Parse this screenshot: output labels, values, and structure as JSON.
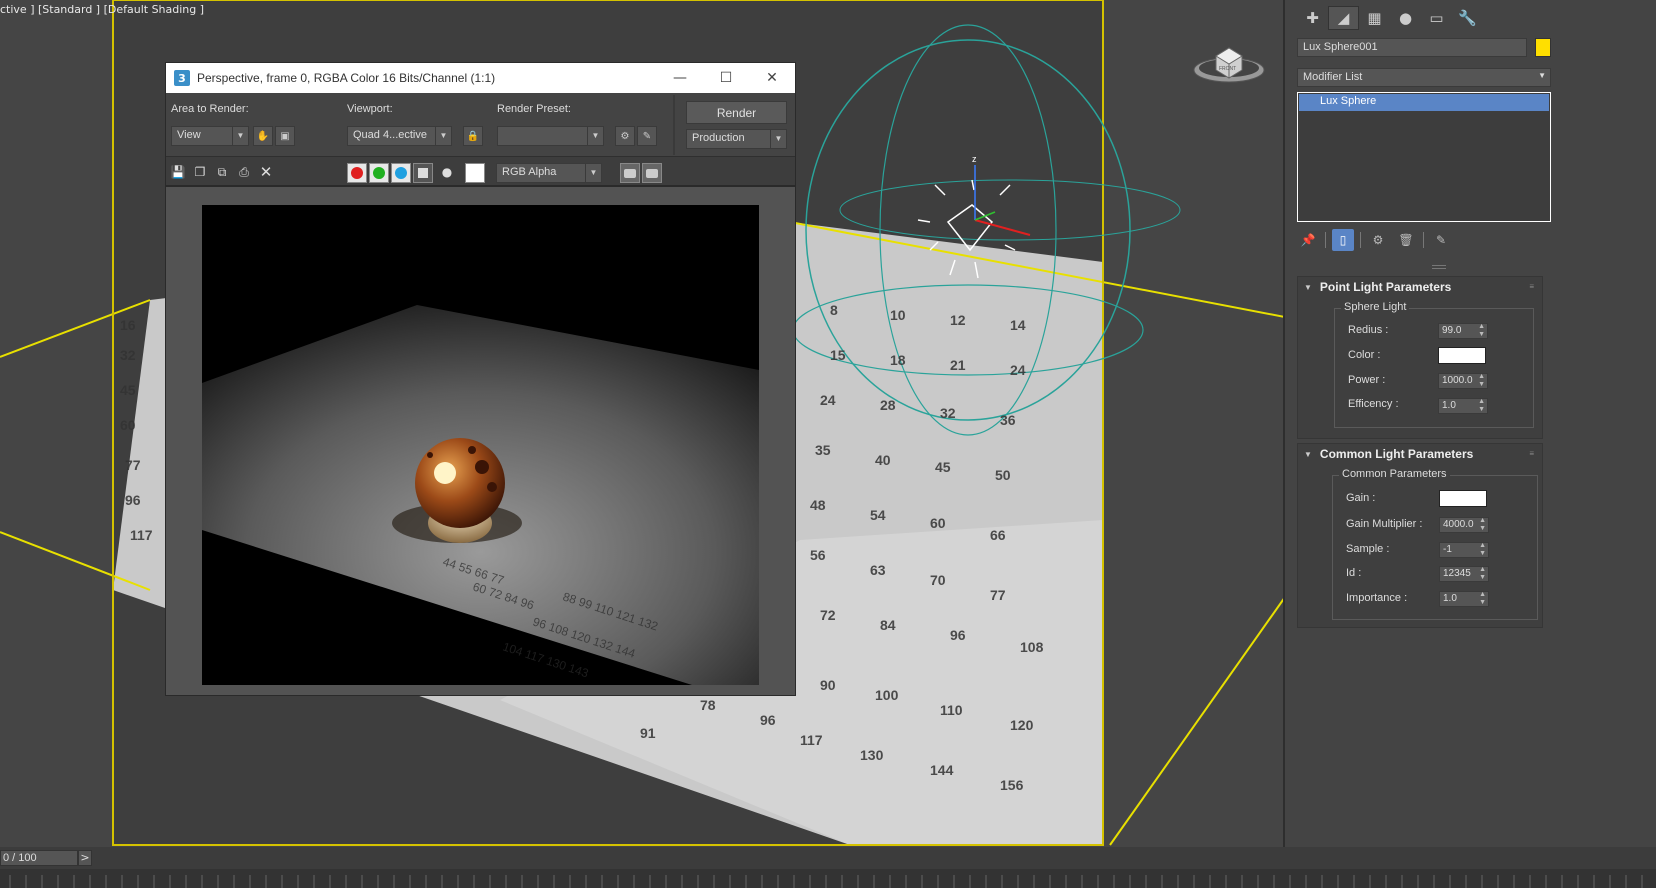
{
  "viewport": {
    "label": "ctive ] [Standard ] [Default Shading ]",
    "viewcube_label": "FRONT"
  },
  "render_window": {
    "app_icon": "3",
    "title": "Perspective, frame 0, RGBA Color 16 Bits/Channel (1:1)",
    "area_to_render_label": "Area to Render:",
    "area_to_render_value": "View",
    "viewport_label": "Viewport:",
    "viewport_value": "Quad 4...ective",
    "render_preset_label": "Render Preset:",
    "render_preset_value": "",
    "render_button": "Render",
    "production_value": "Production",
    "channel_value": "RGB Alpha",
    "icons": [
      "save-icon",
      "copy-icon",
      "clone-icon",
      "print-icon",
      "clear-icon",
      "red-channel-icon",
      "green-channel-icon",
      "blue-channel-icon",
      "alpha-channel-icon",
      "monochrome-icon",
      "swatch-icon"
    ],
    "colors": {
      "red": "#e02020",
      "green": "#20b020",
      "blue": "#20a0e0"
    }
  },
  "command_panel": {
    "tabs": [
      "create-icon",
      "modify-icon",
      "hierarchy-icon",
      "motion-icon",
      "display-icon",
      "utilities-icon"
    ],
    "object_name": "Lux Sphere001",
    "object_color": "#ffdf00",
    "modifier_list": "Modifier List",
    "stack_items": [
      "Lux Sphere"
    ],
    "point_light": {
      "title": "Point Light Parameters",
      "group": "Sphere Light",
      "params": [
        {
          "label": "Redius :",
          "value": "99.0"
        },
        {
          "label": "Color :",
          "value": ""
        },
        {
          "label": "Power :",
          "value": "1000.0"
        },
        {
          "label": "Efficency :",
          "value": "1.0"
        }
      ]
    },
    "common_light": {
      "title": "Common Light Parameters",
      "group": "Common Parameters",
      "params": [
        {
          "label": "Gain :",
          "value": ""
        },
        {
          "label": "Gain Multiplier :",
          "value": "4000.0"
        },
        {
          "label": "Sample :",
          "value": "-1"
        },
        {
          "label": "Id :",
          "value": "12345"
        },
        {
          "label": "Importance :",
          "value": "1.0"
        }
      ]
    }
  },
  "timeline": {
    "frame_counter": "0 / 100",
    "next_label": ">"
  }
}
